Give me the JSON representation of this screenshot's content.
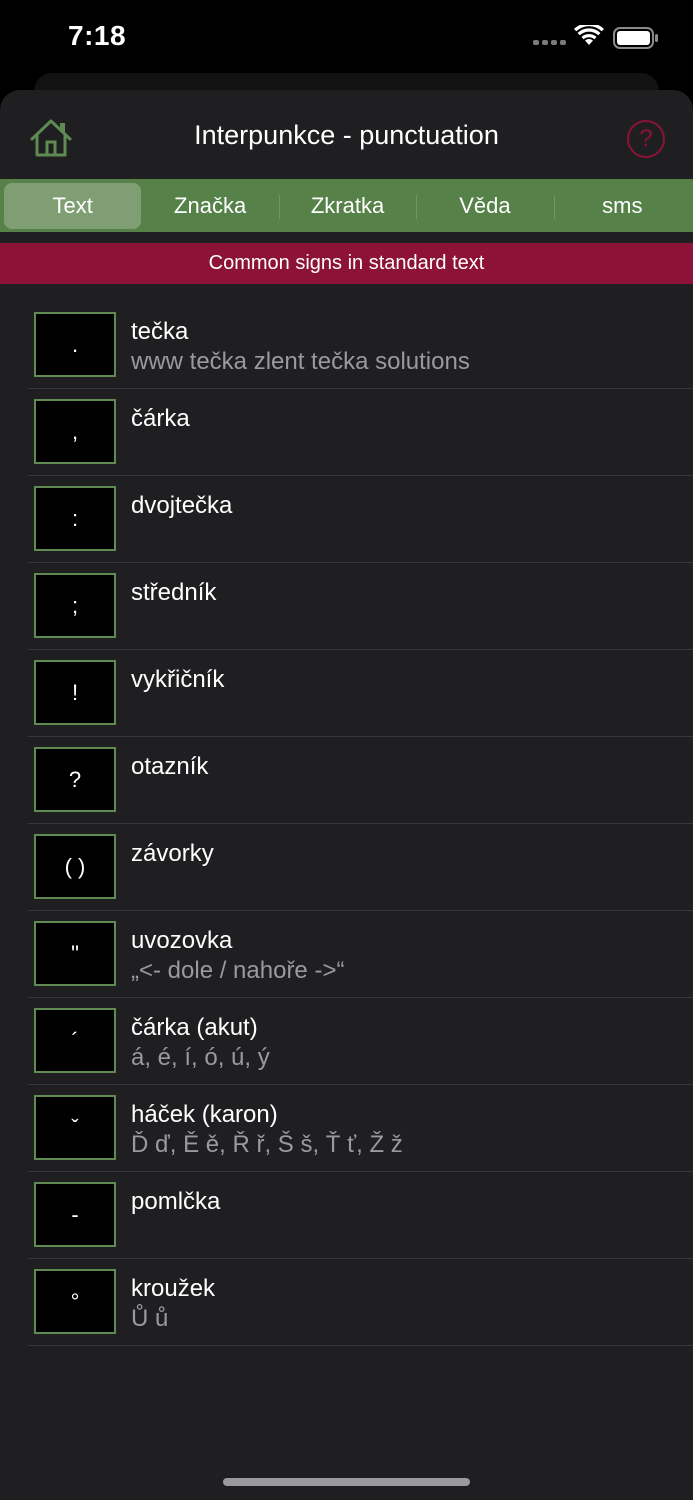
{
  "status_bar": {
    "time": "7:18",
    "signal_icon": "cellular-dots-icon",
    "wifi_icon": "wifi-icon",
    "battery_icon": "battery-icon"
  },
  "header": {
    "title": "Interpunkce - punctuation",
    "home_icon": "home-icon",
    "help_icon": "question-mark-icon",
    "help_symbol": "?"
  },
  "tabs": [
    {
      "label": "Text",
      "active": true
    },
    {
      "label": "Značka",
      "active": false
    },
    {
      "label": "Zkratka",
      "active": false
    },
    {
      "label": "Věda",
      "active": false
    },
    {
      "label": "sms",
      "active": false
    }
  ],
  "banner": "Common signs in standard text",
  "items": [
    {
      "symbol": ".",
      "title": "tečka",
      "subtitle": "www tečka zlent tečka solutions"
    },
    {
      "symbol": ",",
      "title": "čárka",
      "subtitle": ""
    },
    {
      "symbol": ":",
      "title": "dvojtečka",
      "subtitle": ""
    },
    {
      "symbol": ";",
      "title": "středník",
      "subtitle": ""
    },
    {
      "symbol": "!",
      "title": "vykřičník",
      "subtitle": ""
    },
    {
      "symbol": "?",
      "title": "otazník",
      "subtitle": ""
    },
    {
      "symbol": "( )",
      "title": "závorky",
      "subtitle": ""
    },
    {
      "symbol": "\"",
      "title": "uvozovka",
      "subtitle": "„<- dole / nahoře ->“"
    },
    {
      "symbol": "´",
      "title": "čárka (akut)",
      "subtitle": "á, é, í, ó, ú, ý"
    },
    {
      "symbol": "ˇ",
      "title": "háček (karon)",
      "subtitle": "Ď ď, Ě ě, Ř ř, Š š, Ť ť, Ž ž"
    },
    {
      "symbol": "-",
      "title": "pomlčka",
      "subtitle": ""
    },
    {
      "symbol": "°",
      "title": "kroužek",
      "subtitle": "Ů ů"
    }
  ],
  "colors": {
    "tab_bar": "#56824a",
    "banner": "#8c1238",
    "accent_green": "#5f8a52",
    "background": "#1f1f21"
  }
}
